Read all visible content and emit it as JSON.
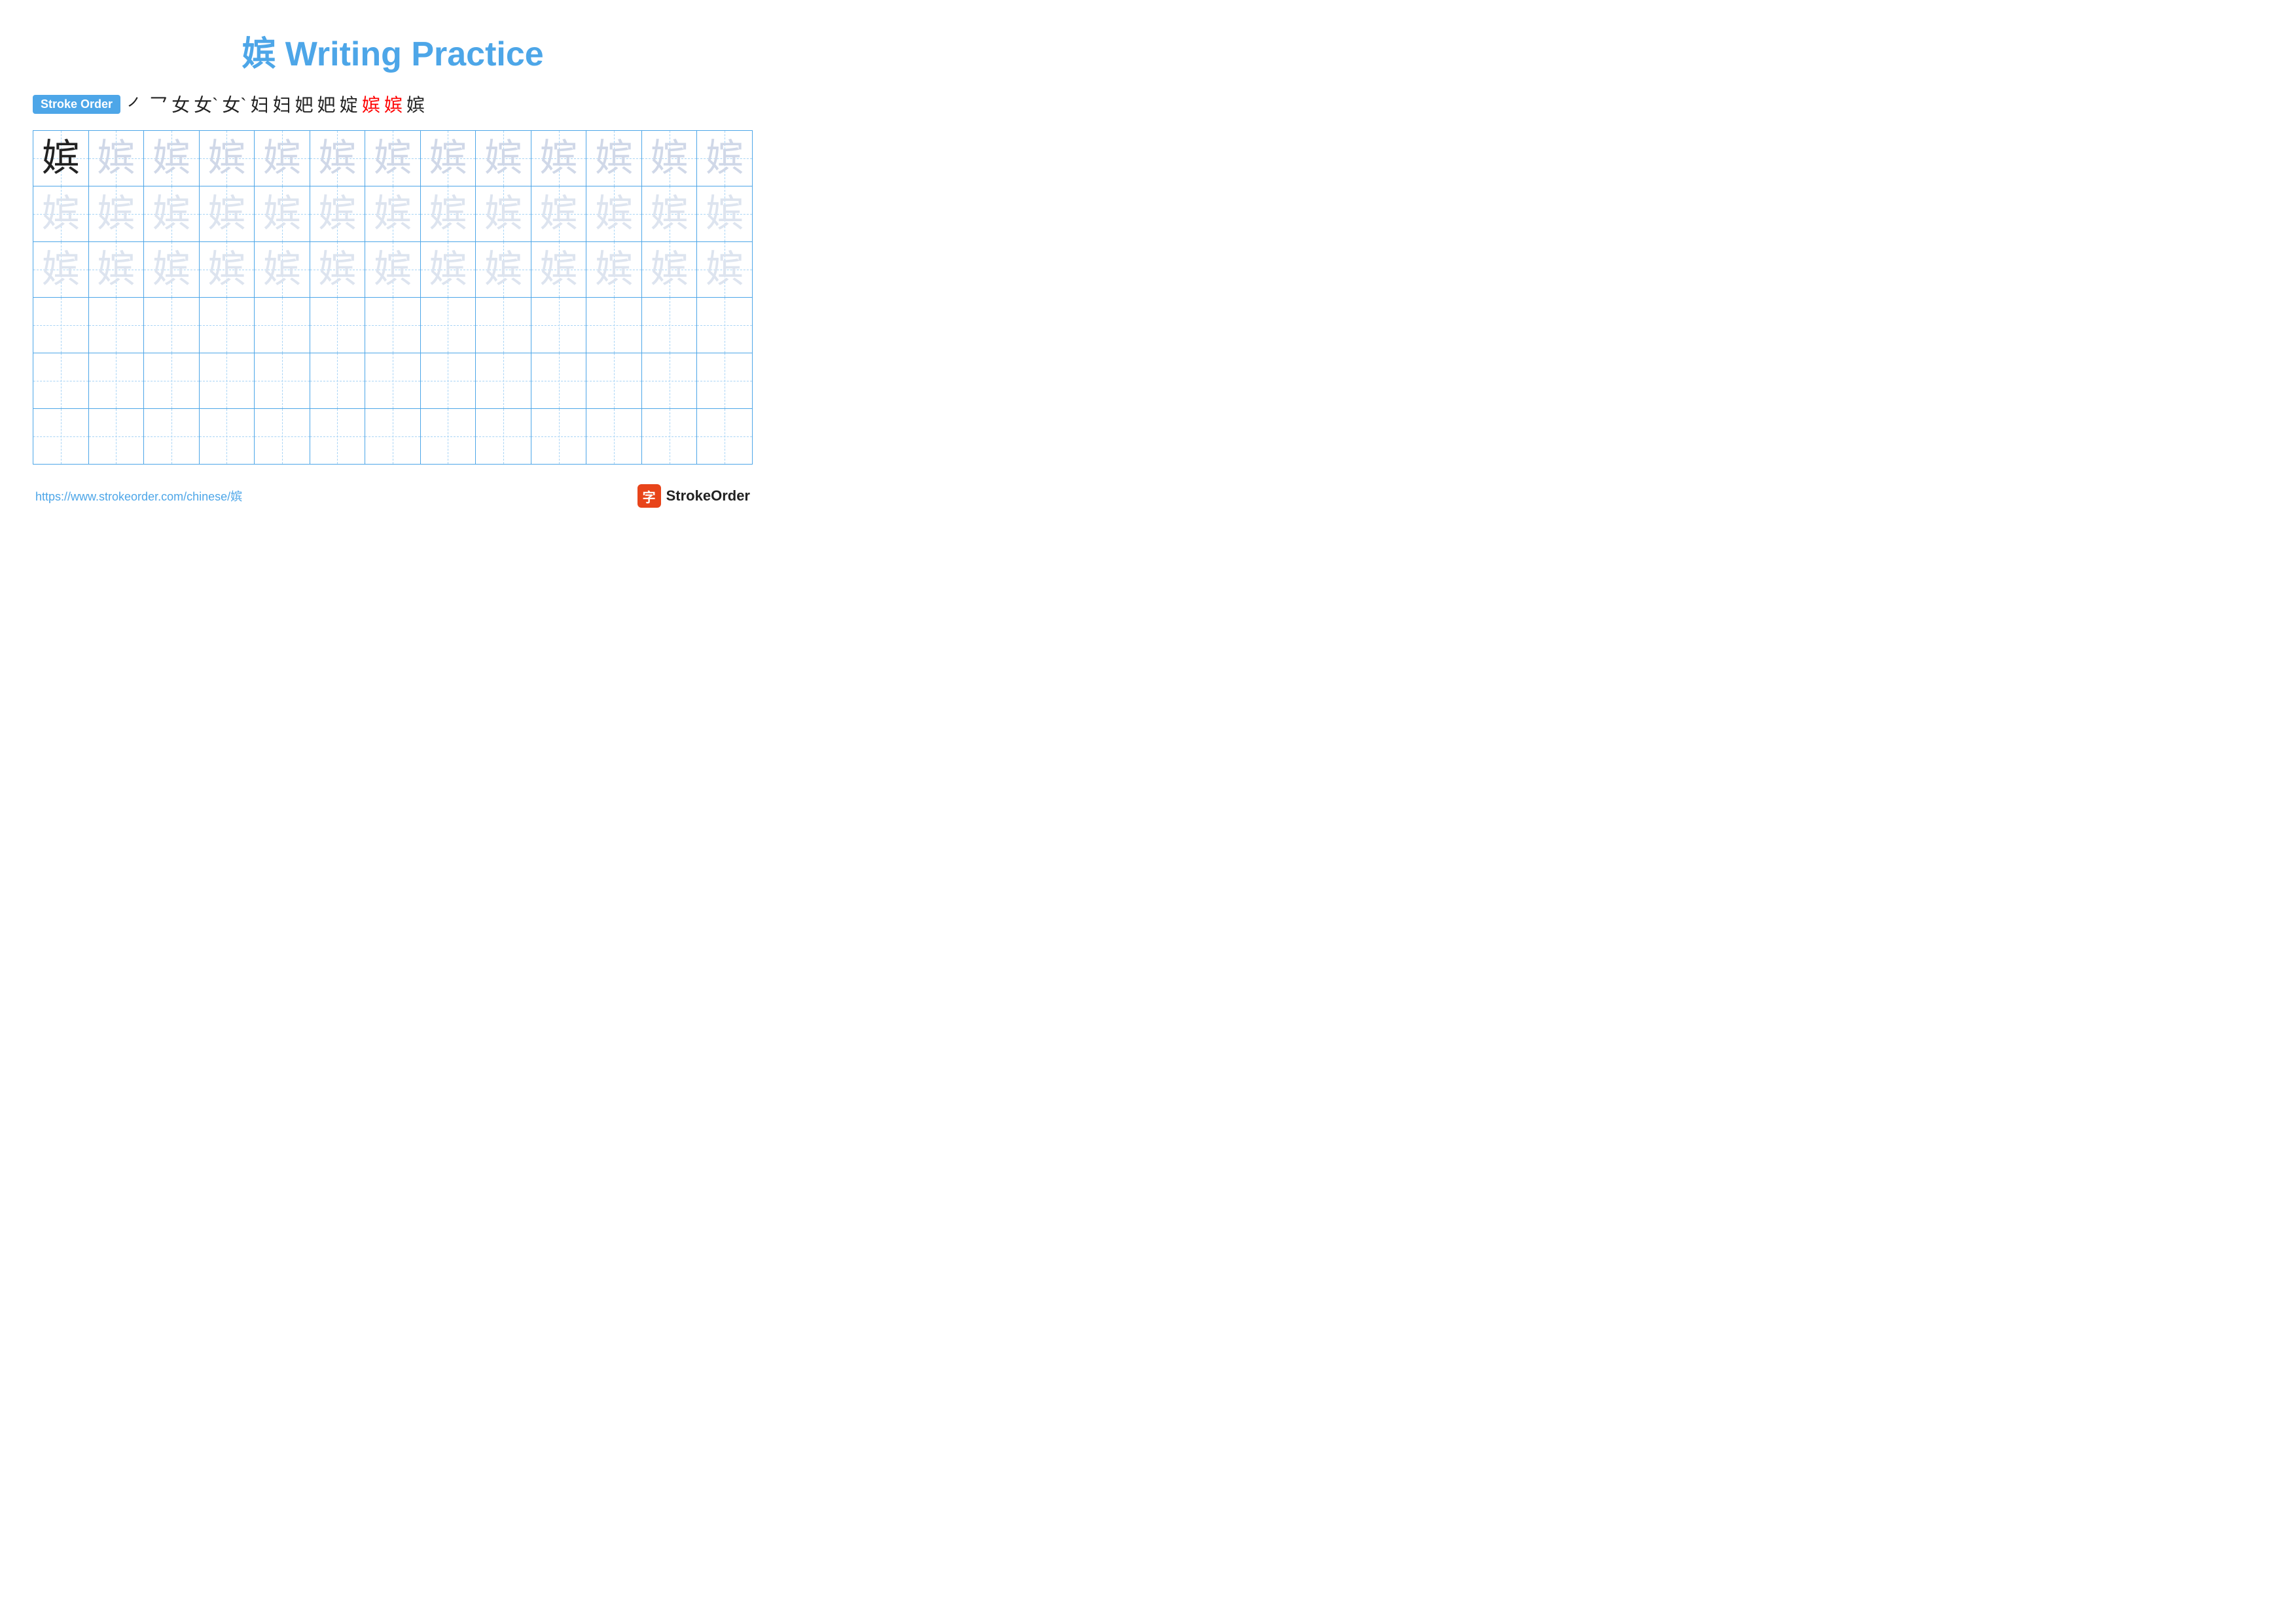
{
  "title": {
    "text": "嫔 Writing Practice",
    "char": "嫔"
  },
  "stroke_order": {
    "badge_label": "Stroke Order",
    "strokes": [
      "㇒",
      "乛",
      "女",
      "女`",
      "女`",
      "妇",
      "妇",
      "妇",
      "妑",
      "婝",
      "嫔",
      "嫔",
      "嫔"
    ]
  },
  "grid": {
    "rows": 6,
    "cols": 13,
    "char": "嫔",
    "row_types": [
      "dark-then-light",
      "lighter",
      "lighter",
      "empty",
      "empty",
      "empty"
    ]
  },
  "footer": {
    "url": "https://www.strokeorder.com/chinese/嫔",
    "brand": "StrokeOrder"
  }
}
